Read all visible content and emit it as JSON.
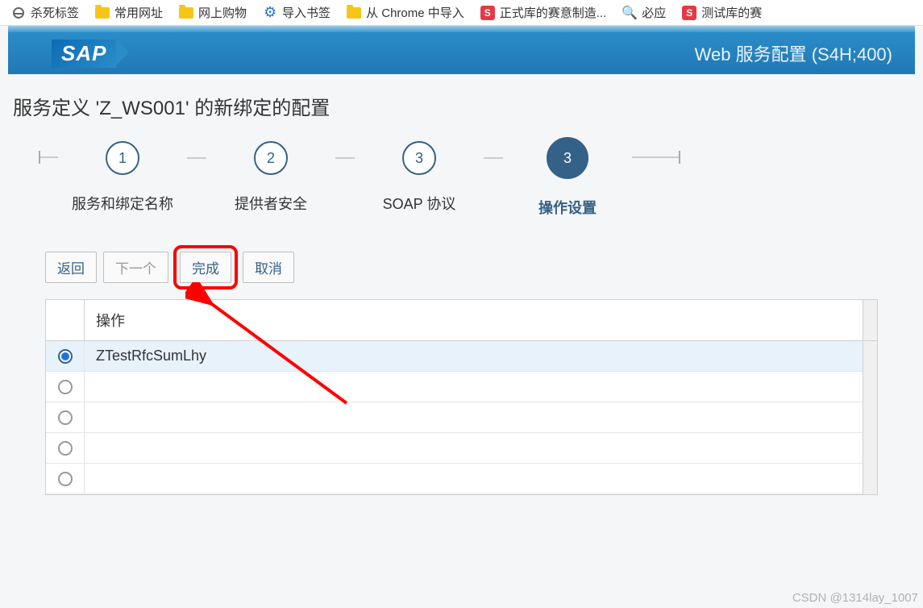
{
  "bookmarks": {
    "kill_tab": "杀死标签",
    "common": "常用网址",
    "shopping": "网上购物",
    "import_bm": "导入书签",
    "from_chrome": "从 Chrome 中导入",
    "formal_lib": "正式库的赛意制造...",
    "biying": "必应",
    "test_lib": "测试库的赛"
  },
  "header": {
    "title": "Web 服务配置 (S4H;400)",
    "logo": "SAP"
  },
  "page": {
    "title": "服务定义 'Z_WS001' 的新绑定的配置"
  },
  "wizard": {
    "steps": [
      {
        "num": "1",
        "label": "服务和绑定名称"
      },
      {
        "num": "2",
        "label": "提供者安全"
      },
      {
        "num": "3",
        "label": "SOAP 协议"
      },
      {
        "num": "3",
        "label": "操作设置"
      }
    ]
  },
  "buttons": {
    "back": "返回",
    "next": "下一个",
    "finish": "完成",
    "cancel": "取消"
  },
  "table": {
    "header_op": "操作",
    "rows": [
      {
        "text": "ZTestRfcSumLhy",
        "selected": true
      },
      {
        "text": "",
        "selected": false
      },
      {
        "text": "",
        "selected": false
      },
      {
        "text": "",
        "selected": false
      },
      {
        "text": "",
        "selected": false
      }
    ]
  },
  "watermark": "CSDN @1314lay_1007"
}
